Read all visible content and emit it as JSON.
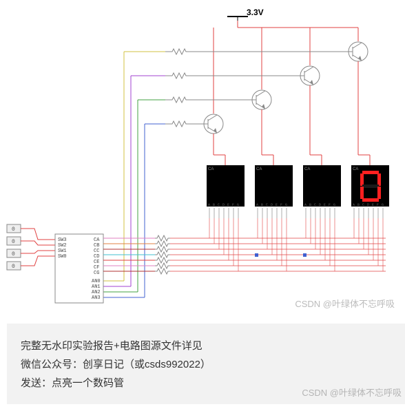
{
  "voltage_label": "3.3V",
  "input_values": [
    "0",
    "0",
    "0",
    "0"
  ],
  "chip_left_labels": [
    "SW3",
    "SW2",
    "SW1",
    "SW0"
  ],
  "chip_right_labels": [
    "CA",
    "CB",
    "CC",
    "CD",
    "CE",
    "CF",
    "CG",
    "AN0",
    "AN1",
    "AN2",
    "AN3"
  ],
  "segment_pin_labels": [
    "A",
    "B",
    "C",
    "D",
    "E",
    "F",
    "G"
  ],
  "displays": [
    {
      "small_label": "CA",
      "active": false
    },
    {
      "small_label": "CA",
      "active": false
    },
    {
      "small_label": "CA",
      "active": false
    },
    {
      "small_label": "CA",
      "active": true,
      "digit": "0"
    }
  ],
  "watermark": "CSDN @叶绿体不忘呼吸",
  "info_line1": "完整无水印实验报告+电路图源文件详见",
  "info_line2_prefix": "微信公众号：",
  "info_line2_value": "创享日记（或csds992022）",
  "info_line3_prefix": "发送：",
  "info_line3_value": "点亮一个数码管",
  "colors": {
    "red": "#e04040",
    "green": "#40a040",
    "blue": "#4060d0",
    "yellow": "#d0c040",
    "purple": "#a040d0",
    "pink": "#e080c0",
    "cyan": "#40c0d0",
    "orange": "#e08040",
    "darkred": "#b03030"
  }
}
